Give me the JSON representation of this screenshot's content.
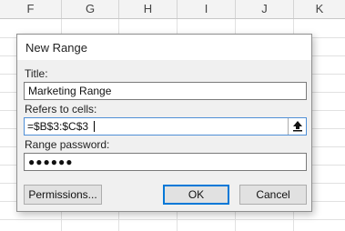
{
  "spreadsheet": {
    "columns": [
      "F",
      "G",
      "H",
      "I",
      "J",
      "K"
    ]
  },
  "dialog": {
    "title": "New Range",
    "title_label": "Title:",
    "title_value": "Marketing Range",
    "refers_label": "Refers to cells:",
    "refers_value": "=$B$3:$C$3",
    "password_label": "Range password:",
    "password_value": "●●●●●●",
    "buttons": {
      "permissions": "Permissions...",
      "ok": "OK",
      "cancel": "Cancel"
    },
    "collapse_icon": "range-collapse-icon"
  }
}
